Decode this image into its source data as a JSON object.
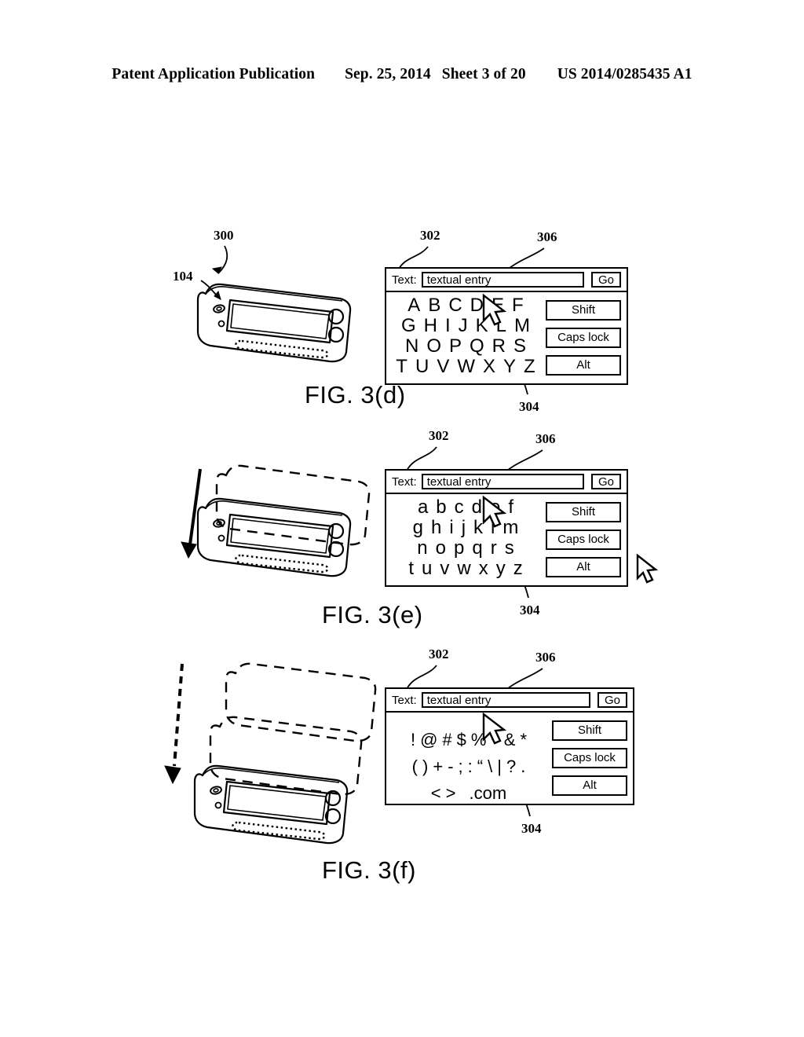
{
  "header": {
    "publication": "Patent Application Publication",
    "date": "Sep. 25, 2014",
    "sheet": "Sheet 3 of 20",
    "patent_number": "US 2014/0285435 A1"
  },
  "figures": [
    {
      "id": "fig-d",
      "caption": "FIG. 3(d)",
      "refs": {
        "device": "300",
        "device_part": "104",
        "panel": "302",
        "cursor": "304",
        "text_field": "306"
      },
      "panel": {
        "text_label": "Text:",
        "text_value": "textual entry",
        "go_label": "Go",
        "key_rows": [
          [
            "A",
            "B",
            "C",
            "D",
            "E",
            "F"
          ],
          [
            "G",
            "H",
            "I",
            "J",
            "K",
            "L",
            "M"
          ],
          [
            "N",
            "O",
            "P",
            "Q",
            "R",
            "S"
          ],
          [
            "T",
            "U",
            "V",
            "W",
            "X",
            "Y",
            "Z"
          ]
        ],
        "modifiers": [
          "Shift",
          "Caps lock",
          "Alt"
        ]
      }
    },
    {
      "id": "fig-e",
      "caption": "FIG. 3(e)",
      "refs": {
        "panel": "302",
        "cursor": "304",
        "text_field": "306"
      },
      "panel": {
        "text_label": "Text:",
        "text_value": "textual entry",
        "go_label": "Go",
        "key_rows": [
          [
            "a",
            "b",
            "c",
            "d",
            "e",
            "f"
          ],
          [
            "g",
            "h",
            "i",
            "j",
            "k",
            "l",
            "m"
          ],
          [
            "n",
            "o",
            "p",
            "q",
            "r",
            "s"
          ],
          [
            "t",
            "u",
            "v",
            "w",
            "x",
            "y",
            "z"
          ]
        ],
        "modifiers": [
          "Shift",
          "Caps lock",
          "Alt"
        ]
      }
    },
    {
      "id": "fig-f",
      "caption": "FIG. 3(f)",
      "refs": {
        "panel": "302",
        "cursor": "304",
        "text_field": "306"
      },
      "panel": {
        "text_label": "Text:",
        "text_value": "textual entry",
        "go_label": "Go",
        "key_rows": [
          [
            "!",
            "@",
            "#",
            "$",
            "%",
            "^",
            "&",
            "*"
          ],
          [
            "(",
            ")",
            "+",
            "-",
            ";",
            ":",
            "“",
            "\\",
            "|",
            "?",
            "."
          ],
          [
            "<",
            ">",
            ".com"
          ]
        ],
        "modifiers": [
          "Shift",
          "Caps lock",
          "Alt"
        ]
      }
    }
  ]
}
